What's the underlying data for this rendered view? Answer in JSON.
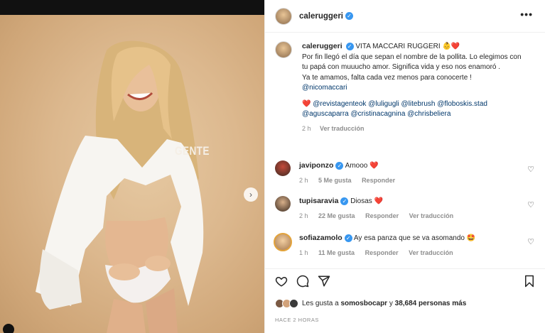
{
  "post": {
    "username": "caleruggeri",
    "more_label": "•••",
    "photo_watermark": "GENTE",
    "next_label": "›",
    "caption_lines": {
      "line1": "VITA MACCARI RUGGERI 👶❤️",
      "line2": "Por fin llegó el día que sepan el nombre de la pollita. Lo elegimos con tu papá con muuucho amor. Significa vida y eso nos enamoró .",
      "line3": "Ya te amamos, falta cada vez menos para conocerte !",
      "mention1": "@nicomaccari",
      "credits_heart": "❤️",
      "credits": "@revistagenteok @luligugli @litebrush @floboskis.stad @aguscaparra @cristinacagnina @chrisbeliera"
    },
    "caption_meta": {
      "time": "2 h",
      "translate": "Ver traducción"
    }
  },
  "comments": [
    {
      "username": "javiponzo",
      "text": "Amooo",
      "emoji": "❤️",
      "time": "2 h",
      "likes": "5 Me gusta",
      "reply": "Responder",
      "translate": ""
    },
    {
      "username": "tupisaravia",
      "text": "Diosas",
      "emoji": "❤️",
      "time": "2 h",
      "likes": "22 Me gusta",
      "reply": "Responder",
      "translate": "Ver traducción"
    },
    {
      "username": "sofiazamolo",
      "text": "Ay esa panza que se va asomando",
      "emoji": "🤩",
      "time": "1 h",
      "likes": "11 Me gusta",
      "reply": "Responder",
      "translate": "Ver traducción"
    }
  ],
  "likes": {
    "prefix": "Les gusta a",
    "user": "somosbocapr",
    "middle": "y",
    "count": "38,684 personas más"
  },
  "posted_time": "HACE 2 HORAS",
  "icons": {
    "like": "heart-outline-icon",
    "comment": "comment-bubble-icon",
    "share": "paper-plane-icon",
    "save": "bookmark-icon",
    "verified": "verified-badge-icon"
  },
  "colors": {
    "link": "#00376b",
    "verified": "#3897f0",
    "meta": "#8e8e8e",
    "text": "#262626"
  }
}
